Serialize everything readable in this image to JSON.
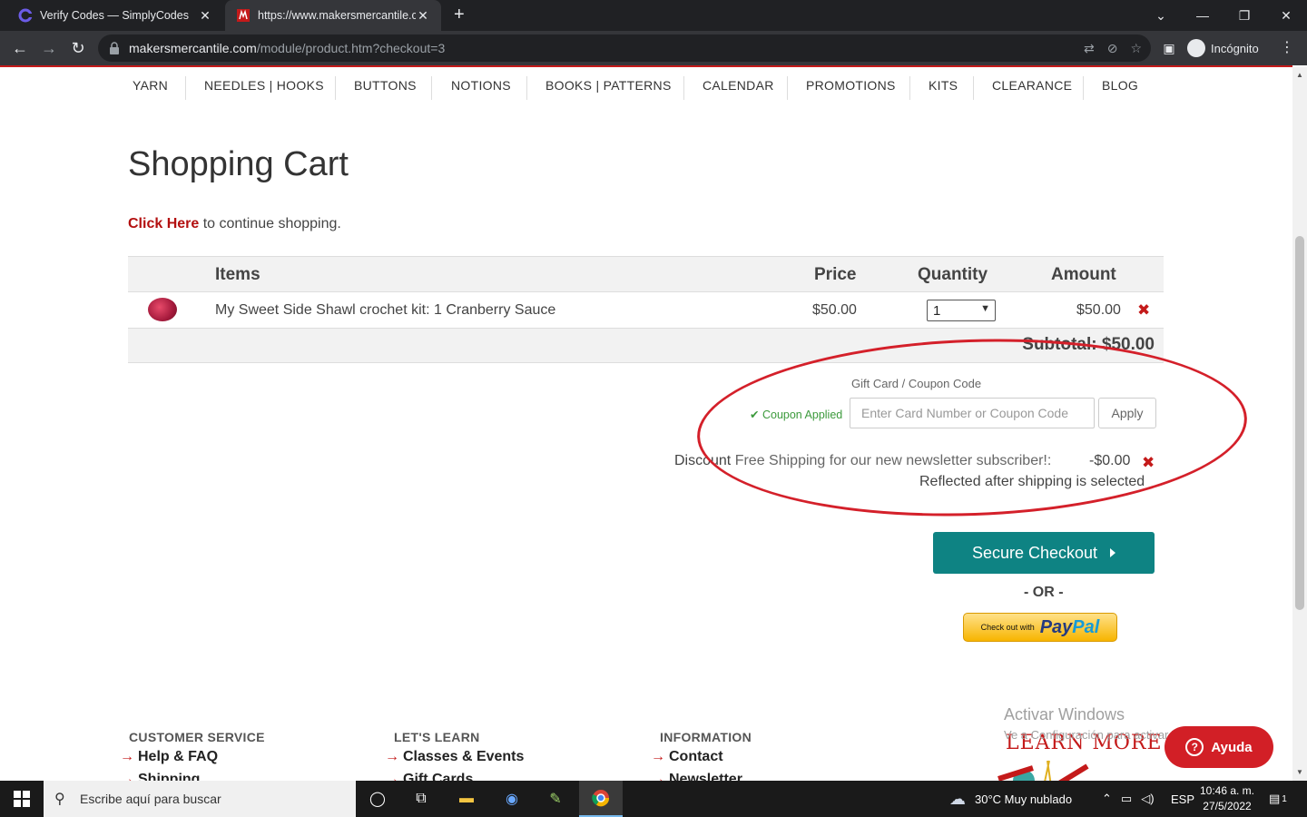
{
  "browser": {
    "tabs": [
      {
        "title": "Verify Codes — SimplyCodes",
        "active": false
      },
      {
        "title": "https://www.makersmercantile.co",
        "active": true
      }
    ],
    "url_domain": "makersmercantile.com",
    "url_path": "/module/product.htm?checkout=3",
    "profile_label": "Incógnito"
  },
  "nav": {
    "items": [
      "YARN",
      "NEEDLES | HOOKS",
      "BUTTONS",
      "NOTIONS",
      "BOOKS | PATTERNS",
      "CALENDAR",
      "PROMOTIONS",
      "KITS",
      "CLEARANCE",
      "BLOG"
    ]
  },
  "page": {
    "title": "Shopping Cart",
    "continue_link": "Click Here",
    "continue_text": " to continue shopping."
  },
  "cart": {
    "columns": {
      "items": "Items",
      "price": "Price",
      "quantity": "Quantity",
      "amount": "Amount"
    },
    "rows": [
      {
        "item": "My Sweet Side Shawl crochet kit: 1 Cranberry Sauce",
        "price": "$50.00",
        "quantity": "1",
        "amount": "$50.00"
      }
    ],
    "subtotal": "Subtotal: $50.00"
  },
  "coupon": {
    "label": "Gift Card / Coupon Code",
    "status": "Coupon Applied",
    "placeholder": "Enter Card Number or Coupon Code",
    "apply_label": "Apply",
    "discount_label": "Discount",
    "discount_promo": " Free Shipping for our new newsletter subscriber!:",
    "discount_amount": "-$0.00",
    "discount_note": "Reflected after shipping is selected"
  },
  "checkout": {
    "button_label": "Secure Checkout",
    "or_label": "- OR -",
    "paypal_prefix": "Check out with",
    "paypal_pay": "Pay",
    "paypal_pal": "Pal"
  },
  "footer": {
    "columns": [
      {
        "title": "CUSTOMER SERVICE",
        "links": [
          "Help & FAQ",
          "Shipping"
        ]
      },
      {
        "title": "LET'S LEARN",
        "links": [
          "Classes & Events",
          "Gift Cards"
        ]
      },
      {
        "title": "INFORMATION",
        "links": [
          "Contact",
          "Newsletter"
        ]
      }
    ],
    "learn_more": "LEARN MORE",
    "help_button": "Ayuda"
  },
  "windows": {
    "watermark_title": "Activar Windows",
    "watermark_sub": "Ve a Configuración para activar Windows.",
    "search_placeholder": "Escribe aquí para buscar",
    "weather": "30°C  Muy nublado",
    "language": "ESP",
    "time": "10:46 a. m.",
    "date": "27/5/2022",
    "notif_count": "1"
  },
  "colors": {
    "brand_red": "#c41a1a",
    "checkout_teal": "#0e8383",
    "annotation_red": "#d4202a"
  }
}
